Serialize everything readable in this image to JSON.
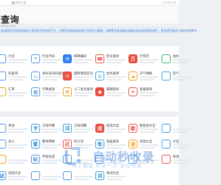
{
  "topbar": {
    "crumb": "网址大全",
    "date": "2024年02月"
  },
  "header": {
    "title": "查询",
    "subtitle": "AXUN.COM"
  },
  "notice": {
    "text": "查询网是全网各类查询工具的综合性查询平台，方便您快速查询各类生活信息与数据，如需更多查询服务请通过网站底部联系我们，更多便民查询工具持续更新中……"
  },
  "panel1": {
    "items": [
      {
        "label": "大全",
        "icon": "grid-icon",
        "color": "#4a90e2",
        "glyph": "",
        "outline": true
      },
      {
        "label": "行业代码",
        "icon": "barcode-icon",
        "color": "#4a90e2",
        "glyph": "≡",
        "outline": true
      },
      {
        "label": "邮政编码",
        "icon": "mail-icon",
        "color": "#2f80ed",
        "glyph": "✉",
        "outline": false
      },
      {
        "label": "区号查询",
        "icon": "phone-icon",
        "color": "#e74c3c",
        "glyph": "☎",
        "outline": true
      },
      {
        "label": "万年历",
        "icon": "calendar-icon",
        "color": "#e74c3c",
        "glyph": "万",
        "outline": false
      },
      {
        "label": "油价",
        "icon": "fuel-icon",
        "color": "#27ae60",
        "glyph": "",
        "outline": true
      },
      {
        "label": "码查询",
        "icon": "code-icon",
        "color": "#4a90e2",
        "glyph": "",
        "outline": true
      },
      {
        "label": "身份证号码查询",
        "icon": "id-card-icon",
        "color": "#4a90e2",
        "glyph": "▭",
        "outline": true
      },
      {
        "label": "国际电话区号",
        "icon": "globe-phone-icon",
        "color": "#e74c3c",
        "glyph": "☏",
        "outline": false
      },
      {
        "label": "生肖查询",
        "icon": "zodiac-icon",
        "color": "#3498db",
        "glyph": "◎",
        "outline": true
      },
      {
        "label": "天气预报",
        "icon": "weather-icon",
        "color": "#f39c12",
        "glyph": "☁",
        "outline": true
      },
      {
        "label": "空气",
        "icon": "air-icon",
        "color": "#3498db",
        "glyph": "",
        "outline": true
      },
      {
        "label": "汇率",
        "icon": "exchange-icon",
        "color": "#f39c12",
        "glyph": "",
        "outline": true
      },
      {
        "label": "行政查询",
        "icon": "admin-icon",
        "color": "#4a90e2",
        "glyph": "▦",
        "outline": true
      },
      {
        "label": "十二生肖查询",
        "icon": "twelve-zodiac-icon",
        "color": "#f39c12",
        "glyph": "✿",
        "outline": true
      },
      {
        "label": "属相查询",
        "icon": "animal-icon",
        "color": "#e74c3c",
        "glyph": "◉",
        "outline": false
      },
      {
        "label": "星座查询",
        "icon": "star-sign-icon",
        "color": "#e74c3c",
        "glyph": "✦",
        "outline": true
      }
    ]
  },
  "panel2": {
    "items": [
      {
        "label": "英语",
        "icon": "english-icon",
        "color": "#4a90e2",
        "glyph": "",
        "outline": true
      },
      {
        "label": "汉语字典",
        "icon": "dictionary-icon",
        "color": "#3498db",
        "glyph": "字",
        "outline": true
      },
      {
        "label": "汉语词典",
        "icon": "word-icon",
        "color": "#3498db",
        "glyph": "词",
        "outline": true
      },
      {
        "label": "成语大全",
        "icon": "idiom-icon",
        "color": "#e74c3c",
        "glyph": "成",
        "outline": false
      },
      {
        "label": "歇后语大全",
        "icon": "saying-icon",
        "color": "#e74c3c",
        "glyph": "歇",
        "outline": true
      },
      {
        "label": "",
        "icon": "misc-icon",
        "color": "#3498db",
        "glyph": "",
        "outline": true
      },
      {
        "label": "反义",
        "icon": "antonym-icon",
        "color": "#4a90e2",
        "glyph": "",
        "outline": true
      },
      {
        "label": "繁体转换",
        "icon": "traditional-icon",
        "color": "#3498db",
        "glyph": "繁",
        "outline": true
      },
      {
        "label": "近义词",
        "icon": "synonym-icon",
        "color": "#e74c3c",
        "glyph": "近",
        "outline": true
      },
      {
        "label": "笔画查询",
        "icon": "stroke-icon",
        "color": "#3498db",
        "glyph": "笔",
        "outline": true
      },
      {
        "label": "谜语大全",
        "icon": "riddle-icon",
        "color": "#f39c12",
        "glyph": "谜",
        "outline": true
      },
      {
        "label": "大全",
        "icon": "all-icon",
        "color": "#3498db",
        "glyph": "",
        "outline": true
      },
      {
        "label": "",
        "icon": "face-icon",
        "color": "#f39c12",
        "glyph": "",
        "outline": true
      },
      {
        "label": "字帖生成",
        "icon": "copybook-icon",
        "color": "#4a90e2",
        "glyph": "帖",
        "outline": true
      },
      {
        "label": "",
        "icon": "blank-icon",
        "color": "#3498db",
        "glyph": "",
        "outline": true
      },
      {
        "label": "",
        "icon": "blank2-icon",
        "color": "#3498db",
        "glyph": "",
        "outline": true
      },
      {
        "label": "",
        "icon": "blank3-icon",
        "color": "#3498db",
        "glyph": "",
        "outline": true
      },
      {
        "label": "谜语",
        "icon": "puzzle-icon",
        "color": "#e74c3c",
        "glyph": "",
        "outline": true
      },
      {
        "label": "谜语大全",
        "icon": "riddle-all-icon",
        "color": "#4a90e2",
        "glyph": "谜",
        "outline": true
      },
      {
        "label": "",
        "icon": "blank4-icon",
        "color": "#4a90e2",
        "glyph": "",
        "outline": true
      },
      {
        "label": "",
        "icon": "blank5-icon",
        "color": "#4a90e2",
        "glyph": "",
        "outline": true
      },
      {
        "label": "单词大全",
        "icon": "vocabulary-icon",
        "color": "#3498db",
        "glyph": "词",
        "outline": true
      }
    ]
  },
  "watermark": {
    "title": "自动秒收录",
    "slogan": "做上链接 秒访一次 自动收录"
  }
}
